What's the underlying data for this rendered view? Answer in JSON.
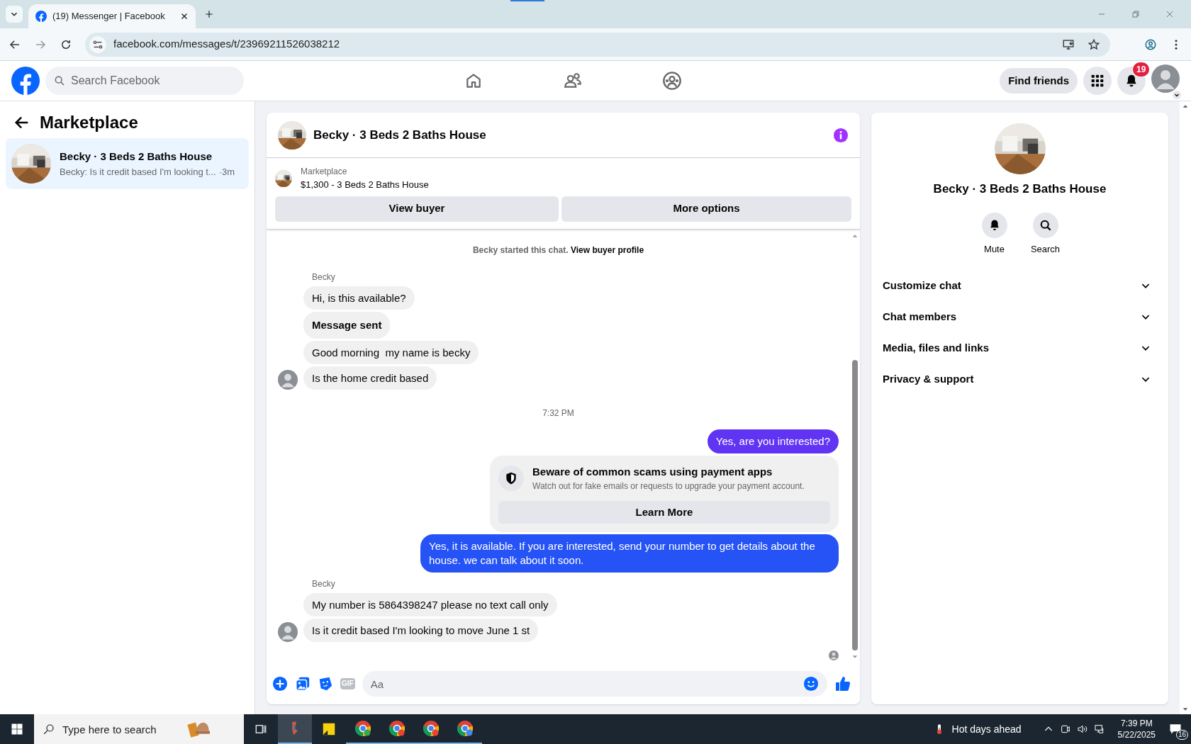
{
  "browser": {
    "tab_title": "(19) Messenger | Facebook",
    "url": "facebook.com/messages/t/23969211526038212"
  },
  "header": {
    "search_placeholder": "Search Facebook",
    "find_friends": "Find friends",
    "notification_count": "19"
  },
  "sidebar": {
    "title": "Marketplace",
    "conversations": [
      {
        "title": "Becky · 3 Beds 2 Baths House",
        "preview": "Becky: Is it credit based I'm looking t...",
        "time": "·3m",
        "selected": true
      }
    ]
  },
  "chat": {
    "title": "Becky · 3 Beds 2 Baths House",
    "listing": {
      "label": "Marketplace",
      "title": "$1,300 - 3 Beds 2 Baths House"
    },
    "buttons": [
      "View buyer",
      "More options"
    ],
    "started": {
      "text": "Becky started this chat.",
      "link": "View buyer profile"
    },
    "messages": [
      {
        "kind": "sender",
        "text": "Becky"
      },
      {
        "kind": "incoming",
        "text": "Hi, is this available?",
        "bold": false,
        "avatar": false
      },
      {
        "kind": "incoming",
        "text": "Message sent",
        "bold": true,
        "avatar": false
      },
      {
        "kind": "incoming",
        "text": "Good morning  my name is becky",
        "bold": false,
        "avatar": false
      },
      {
        "kind": "incoming",
        "text": "Is the home credit based",
        "bold": false,
        "avatar": true
      },
      {
        "kind": "timestamp",
        "text": "7:32 PM"
      },
      {
        "kind": "outgoing",
        "text": "Yes, are you interested?",
        "color": "#6134f4"
      },
      {
        "kind": "notice",
        "title": "Beware of common scams using payment apps",
        "text": "Watch out for fake emails or requests to upgrade your payment account.",
        "button": "Learn More"
      },
      {
        "kind": "outgoing",
        "text": "Yes, it is available. If you are interested, send your number to get details about the house. we can talk about it soon.",
        "color": "#2653f5"
      },
      {
        "kind": "sender",
        "text": "Becky"
      },
      {
        "kind": "incoming",
        "text": "My number is 5864398247 please no text call only",
        "bold": false,
        "avatar": false
      },
      {
        "kind": "incoming",
        "text": "Is it credit based I'm looking to move June 1 st",
        "bold": false,
        "avatar": true
      }
    ],
    "gif_label": "GIF",
    "input_placeholder": "Aa"
  },
  "details": {
    "title": "Becky · 3 Beds 2 Baths House",
    "actions": [
      {
        "kind": "mute",
        "label": "Mute"
      },
      {
        "kind": "search",
        "label": "Search"
      }
    ],
    "sections": [
      {
        "label": "Customize chat",
        "expanded": false
      },
      {
        "label": "Chat members",
        "expanded": false
      },
      {
        "label": "Media, files and links",
        "expanded": false
      },
      {
        "label": "Privacy & support",
        "expanded": false
      }
    ]
  },
  "taskbar": {
    "search_placeholder": "Type here to search",
    "weather": "Hot days ahead",
    "time": "7:39 PM",
    "date": "5/22/2025",
    "notification_count": "16"
  }
}
